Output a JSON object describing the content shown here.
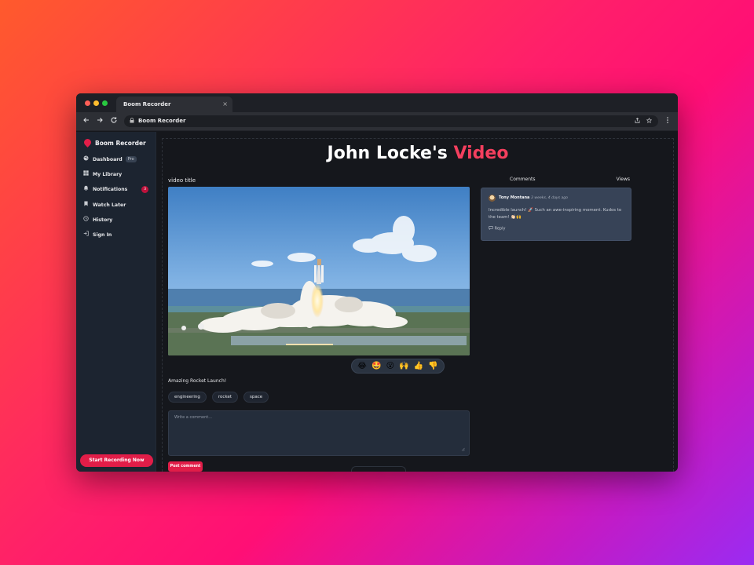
{
  "browser": {
    "tab_title": "Boom Recorder",
    "address_text": "Boom Recorder",
    "close_glyph": "×"
  },
  "sidebar": {
    "brand": "Boom Recorder",
    "items": [
      {
        "label": "Dashboard",
        "icon": "palette-icon",
        "badge": "Pro"
      },
      {
        "label": "My Library",
        "icon": "grid-icon"
      },
      {
        "label": "Notifications",
        "icon": "bell-icon",
        "count": "3"
      },
      {
        "label": "Watch Later",
        "icon": "bookmark-icon"
      },
      {
        "label": "History",
        "icon": "clock-icon"
      },
      {
        "label": "Sign In",
        "icon": "sign-in-icon"
      }
    ],
    "record_button": "Start Recording Now"
  },
  "main": {
    "title_prefix": "John Locke's ",
    "title_accent": "Video",
    "video_title": "video title",
    "reactions": [
      "😂",
      "🤩",
      "😮",
      "🙌",
      "👍",
      "👎"
    ],
    "description": "Amazing Rocket Launch!",
    "tags": [
      "engineering",
      "rocket",
      "space"
    ],
    "comment_placeholder": "Write a comment...",
    "post_button": "Post comment"
  },
  "panel": {
    "tab_comments": "Comments",
    "tab_views": "Views",
    "comment": {
      "author": "Tony Montana",
      "time": "3 weeks, 4 days ago",
      "text": "Incredible launch! 🚀 Such an awe-inspiring moment. Kudos to the team! 👏🏻🙌",
      "reply": "Reply"
    }
  },
  "colors": {
    "accent": "#e11d48",
    "title_accent": "#f43f5e",
    "sidebar_bg": "#1c2430",
    "page_bg": "#15171c",
    "card_bg": "#374357"
  }
}
